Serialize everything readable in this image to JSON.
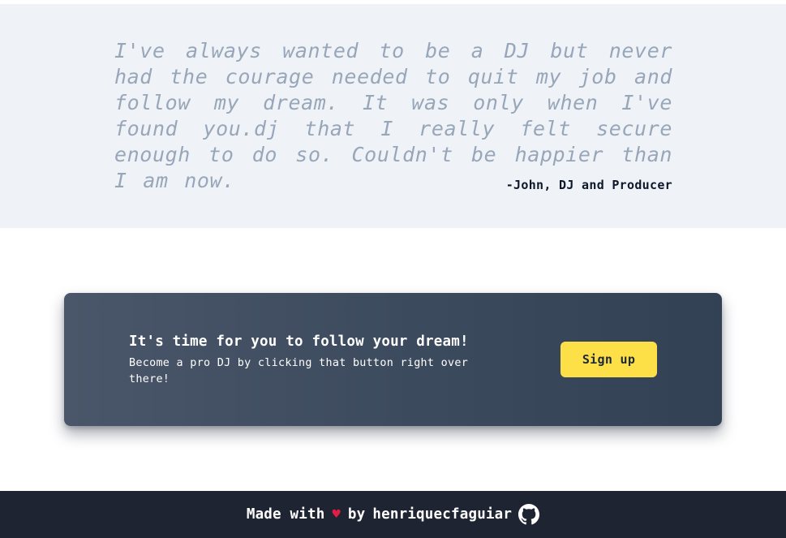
{
  "testimonial": {
    "quote": "I've always wanted to be a DJ but never had the courage needed to quit my job and follow my dream. It was only when I've found you.dj that I really felt secure enough to do so. Couldn't be happier than I am now.",
    "author": "-John, DJ and Producer"
  },
  "cta": {
    "title": "It's time for you to follow your dream!",
    "subtitle": "Become a pro DJ by clicking that button right over there!",
    "button_label": "Sign up"
  },
  "footer": {
    "made_with": "Made with",
    "heart": "♥",
    "by": "by",
    "author": "henriquecfaguiar",
    "icon": "github-icon"
  },
  "colors": {
    "testimonial_bg": "#eff3f8",
    "quote_text": "#98a6b9",
    "card_bg": "#3c4a5e",
    "button_bg": "#fde047",
    "footer_bg": "#1e2432",
    "heart": "#e11d48"
  }
}
